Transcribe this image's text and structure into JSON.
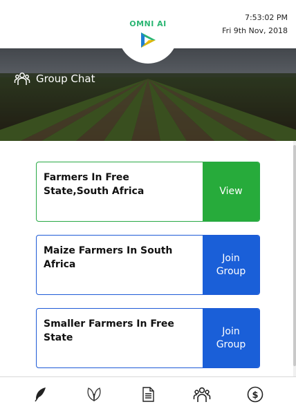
{
  "status": {
    "time": "7:53:02 PM",
    "date": "Fri 9th Nov, 2018"
  },
  "brand": {
    "name": "OMNI AI"
  },
  "banner": {
    "title": "Group Chat",
    "icon": "group-icon"
  },
  "groups": [
    {
      "name": "Farmers In Free State,South Africa",
      "action": "View",
      "style": "green"
    },
    {
      "name": "Maize Farmers In South Africa",
      "action": "Join Group",
      "style": "blue"
    },
    {
      "name": "Smaller Farmers In Free State",
      "action": "Join Group",
      "style": "blue"
    }
  ],
  "nav": {
    "items": [
      {
        "icon": "feather-icon"
      },
      {
        "icon": "leaf-icon"
      },
      {
        "icon": "document-icon"
      },
      {
        "icon": "group-icon",
        "active": true
      },
      {
        "icon": "dollar-icon"
      }
    ]
  },
  "colors": {
    "green": "#27ab3b",
    "blue": "#1a5fd8",
    "brand": "#2bb673"
  }
}
